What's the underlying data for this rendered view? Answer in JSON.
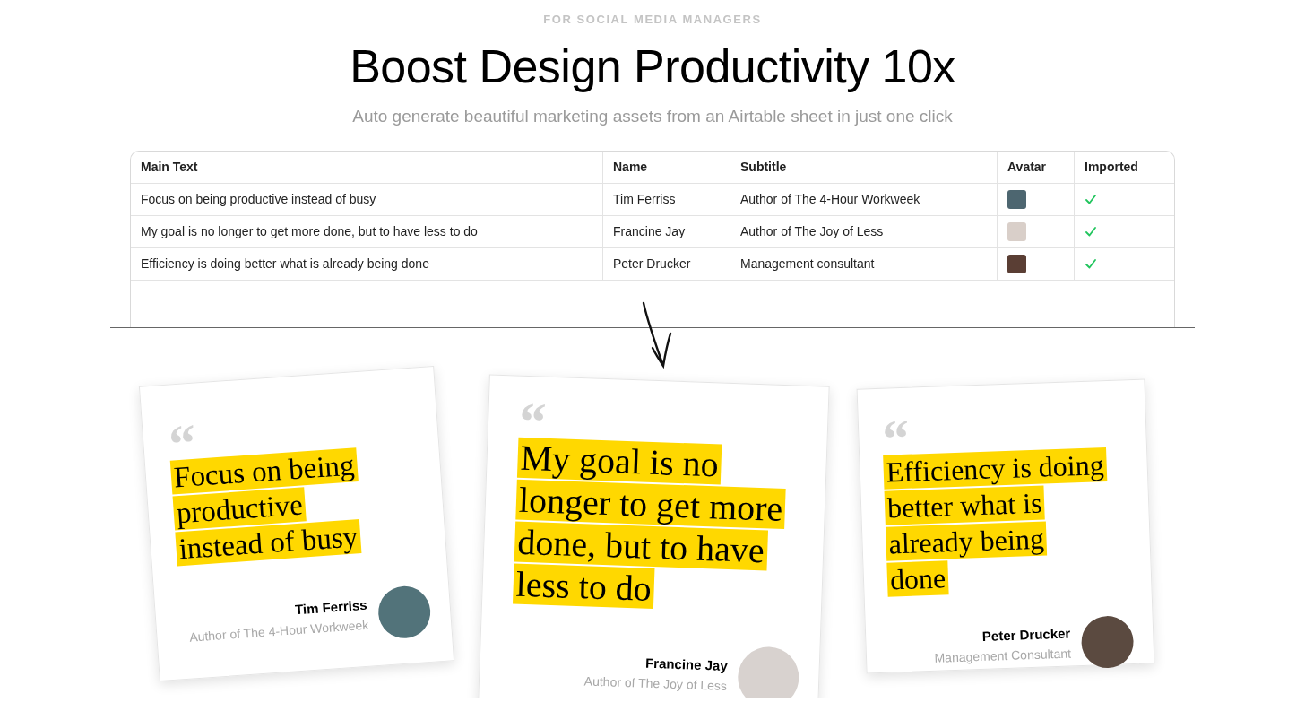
{
  "eyebrow": "FOR SOCIAL MEDIA MANAGERS",
  "title": "Boost Design Productivity 10x",
  "subtitle": "Auto generate beautiful marketing assets from an Airtable sheet in just one click",
  "table": {
    "columns": [
      "Main Text",
      "Name",
      "Subtitle",
      "Avatar",
      "Imported"
    ],
    "rows": [
      {
        "main_text": "Focus on being productive instead of busy",
        "name": "Tim Ferriss",
        "subtitle": "Author of The 4-Hour Workweek",
        "imported": true
      },
      {
        "main_text": "My goal is no longer to get more done, but to have less to do",
        "name": "Francine Jay",
        "subtitle": "Author of The Joy of Less",
        "imported": true
      },
      {
        "main_text": "Efficiency is doing better what is already being done",
        "name": "Peter Drucker",
        "subtitle": "Management consultant",
        "imported": true
      }
    ]
  },
  "cards": [
    {
      "quote_mark": "“",
      "quote_lines": [
        "Focus on being",
        "productive",
        "instead of busy"
      ],
      "name": "Tim Ferriss",
      "subtitle": "Author of The 4-Hour Workweek"
    },
    {
      "quote_mark": "“",
      "quote_lines": [
        "My goal is no",
        "longer to get more",
        "done, but to have",
        "less to do"
      ],
      "name": "Francine Jay",
      "subtitle": "Author of The Joy of Less"
    },
    {
      "quote_mark": "“",
      "quote_lines": [
        "Efficiency is doing",
        "better what is",
        "already being",
        "done"
      ],
      "name": "Peter Drucker",
      "subtitle": "Management Consultant"
    }
  ]
}
